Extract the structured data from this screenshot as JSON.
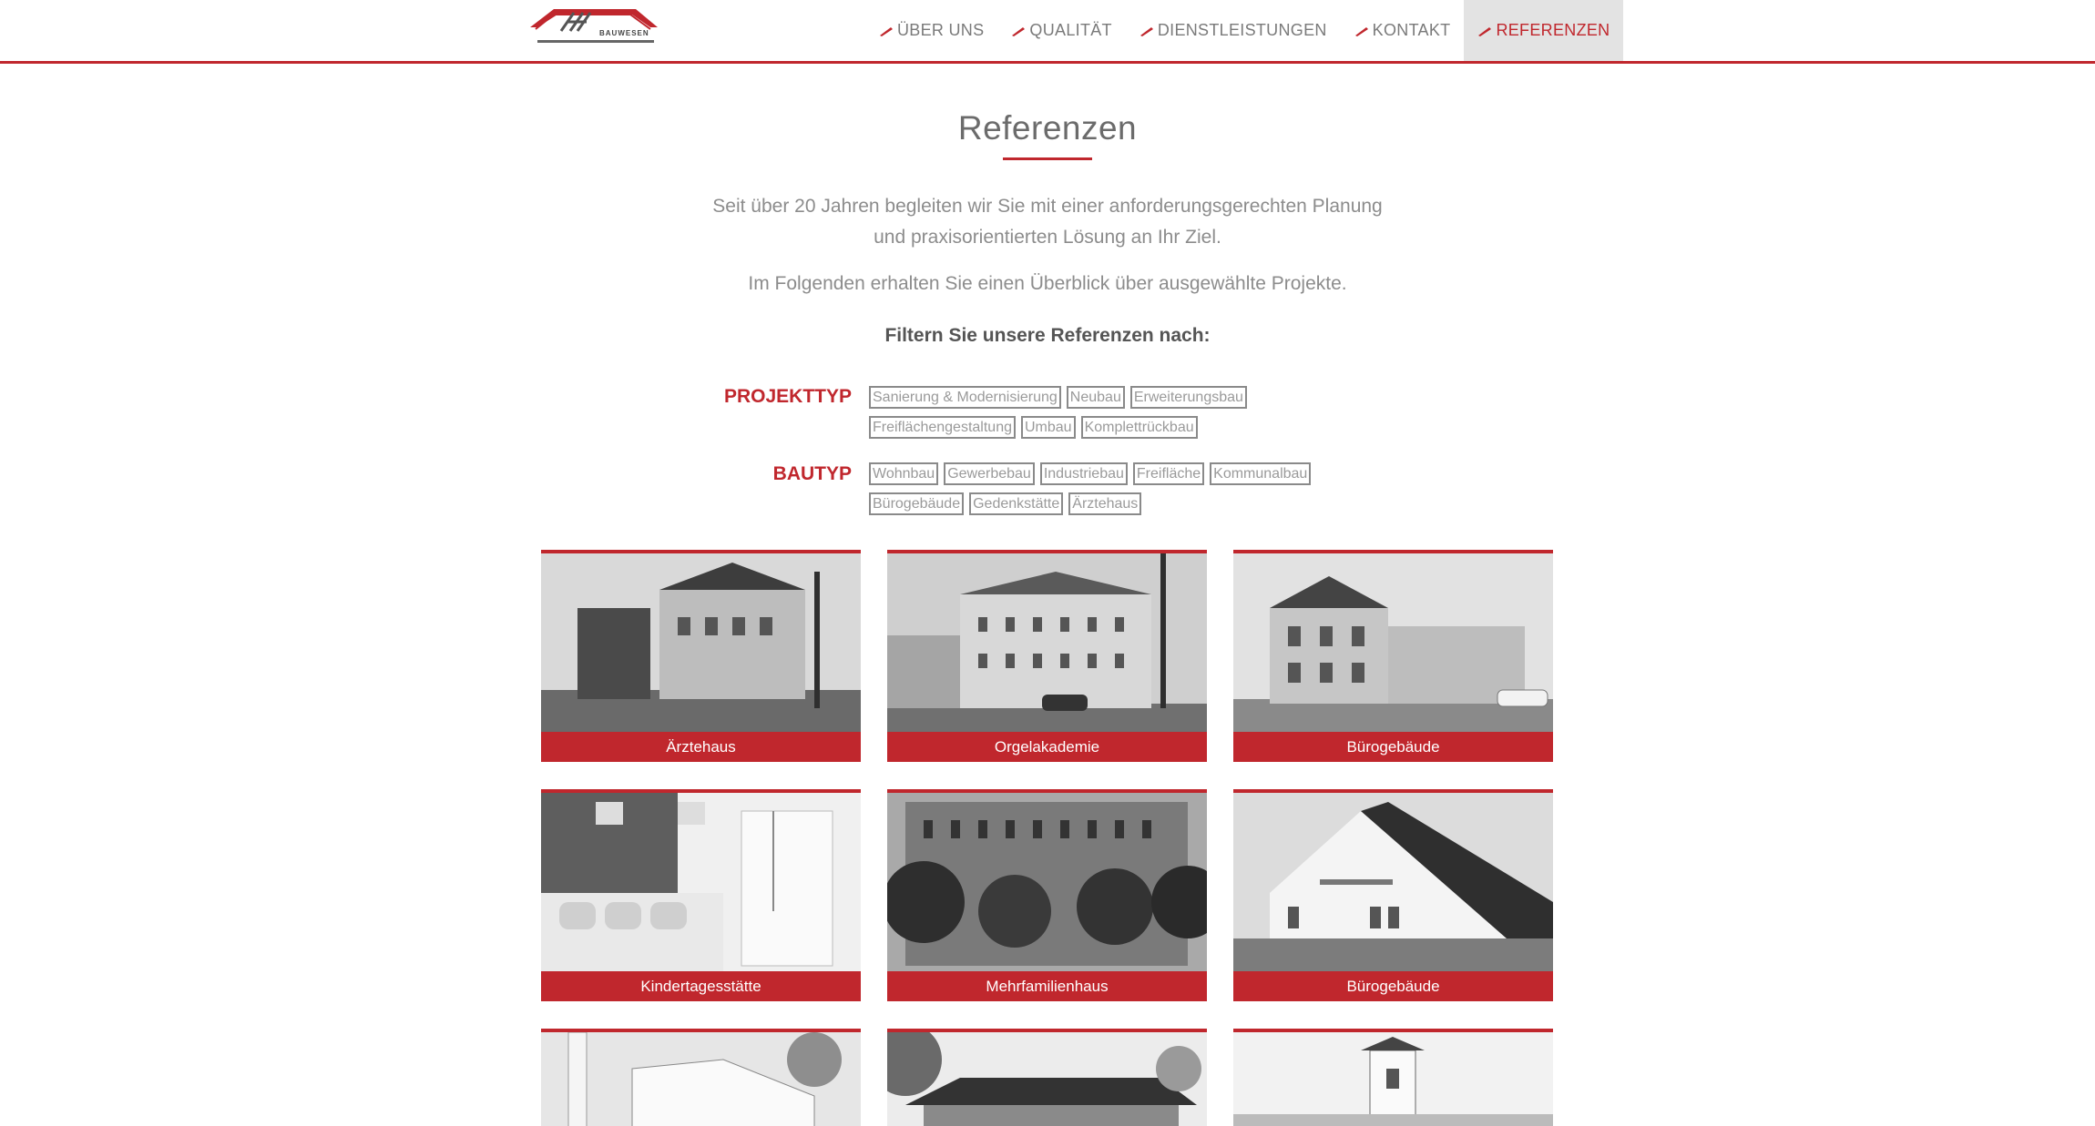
{
  "nav": {
    "items": [
      {
        "label": "ÜBER UNS"
      },
      {
        "label": "QUALITÄT"
      },
      {
        "label": "DIENSTLEISTUNGEN"
      },
      {
        "label": "KONTAKT"
      },
      {
        "label": "REFERENZEN",
        "active": true
      }
    ],
    "logo_text": "BAUWESEN"
  },
  "page": {
    "title": "Referenzen",
    "intro_line1": "Seit über 20 Jahren begleiten wir Sie mit einer anforderungsgerechten Planung",
    "intro_line2": "und praxisorientierten Lösung an Ihr Ziel.",
    "intro_line3": "Im Folgenden erhalten Sie einen Überblick über ausgewählte Projekte.",
    "filter_heading": "Filtern Sie unsere Referenzen nach:"
  },
  "filters": {
    "projekttyp": {
      "label": "PROJEKTTYP",
      "row1": [
        "Sanierung & Modernisierung",
        "Neubau",
        "Erweiterungsbau"
      ],
      "row2": [
        "Freiflächengestaltung",
        "Umbau",
        "Komplettrückbau"
      ]
    },
    "bautyp": {
      "label": "BAUTYP",
      "row1": [
        "Wohnbau",
        "Gewerbebau",
        "Industriebau",
        "Freifläche",
        "Kommunalbau"
      ],
      "row2": [
        "Bürogebäude",
        "Gedenkstätte",
        "Ärztehaus"
      ]
    }
  },
  "gallery": [
    {
      "caption": "Ärztehaus"
    },
    {
      "caption": "Orgelakademie"
    },
    {
      "caption": "Bürogebäude"
    },
    {
      "caption": "Kindertagesstätte"
    },
    {
      "caption": "Mehrfamilienhaus"
    },
    {
      "caption": "Bürogebäude"
    }
  ],
  "colors": {
    "accent": "#c0272d",
    "nav_active_bg": "#e3e3e3",
    "text": "#6e6e6e"
  }
}
